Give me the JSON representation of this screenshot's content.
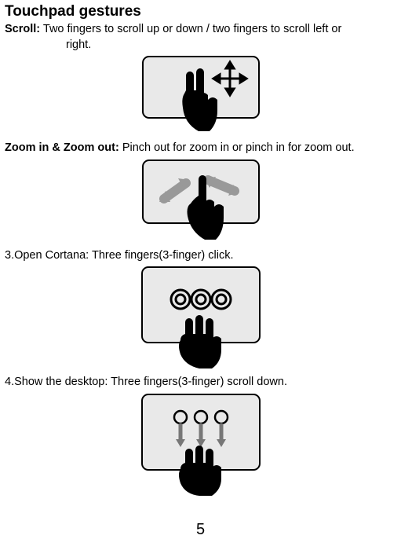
{
  "title": "Touchpad gestures",
  "items": [
    {
      "label": "Scroll:",
      "desc_first": "Two fingers to scroll up or down / two fingers to scroll left or",
      "desc_cont": "right."
    },
    {
      "label": "Zoom in & Zoom out:",
      "desc_first": "Pinch out for zoom in or pinch in for zoom out."
    },
    {
      "label": "",
      "desc_first": "3.Open Cortana: Three fingers(3-finger) click."
    },
    {
      "label": "",
      "desc_first": "4.Show the desktop: Three fingers(3-finger) scroll down."
    }
  ],
  "page_number": "5"
}
